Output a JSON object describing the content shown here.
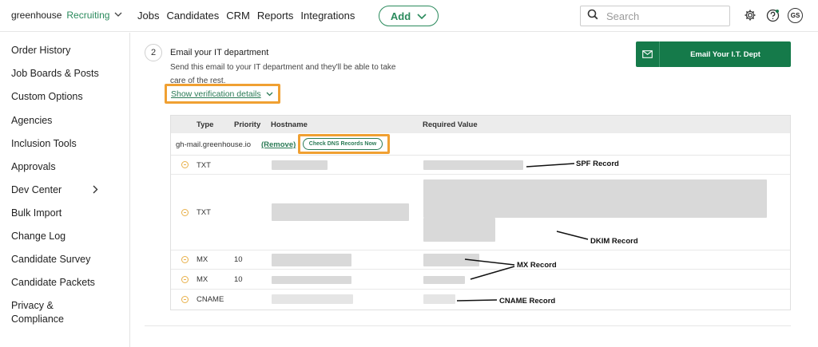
{
  "header": {
    "logo_brand": "greenhouse",
    "logo_product": "Recruiting",
    "nav": [
      "Jobs",
      "Candidates",
      "CRM",
      "Reports",
      "Integrations"
    ],
    "add_label": "Add",
    "search_placeholder": "Search",
    "avatar_initials": "GS",
    "icons": [
      "chevron-down-icon",
      "search-icon",
      "gear-icon",
      "help-icon"
    ]
  },
  "sidebar": {
    "items": [
      "Order History",
      "Job Boards & Posts",
      "Custom Options",
      "Agencies",
      "Inclusion Tools",
      "Approvals",
      "Dev Center",
      "Bulk Import",
      "Change Log",
      "Candidate Survey",
      "Candidate Packets",
      "Privacy &",
      "Compliance"
    ]
  },
  "step": {
    "number": "2",
    "title": "Email your IT department",
    "description": "Send this email to your IT department and they'll be able to take care of the rest.",
    "show_details": "Show verification details",
    "email_button": "Email Your I.T. Dept"
  },
  "table": {
    "headers": [
      "Type",
      "Priority",
      "Hostname",
      "Required Value"
    ],
    "hostname": "gh-mail.greenhouse.io",
    "remove": "(Remove)",
    "check_dns": "Check DNS Records Now",
    "records": [
      {
        "type": "TXT",
        "priority": ""
      },
      {
        "type": "TXT",
        "priority": ""
      },
      {
        "type": "MX",
        "priority": "10"
      },
      {
        "type": "MX",
        "priority": "10"
      },
      {
        "type": "CNAME",
        "priority": ""
      }
    ]
  },
  "annotations": {
    "spf": "SPF Record",
    "dkim": "DKIM Record",
    "mx": "MX Record",
    "cname": "CNAME Record"
  },
  "colors": {
    "brand_green": "#157a4a",
    "highlight_orange": "#f0a032",
    "warning_yellow": "#e8b04a"
  }
}
